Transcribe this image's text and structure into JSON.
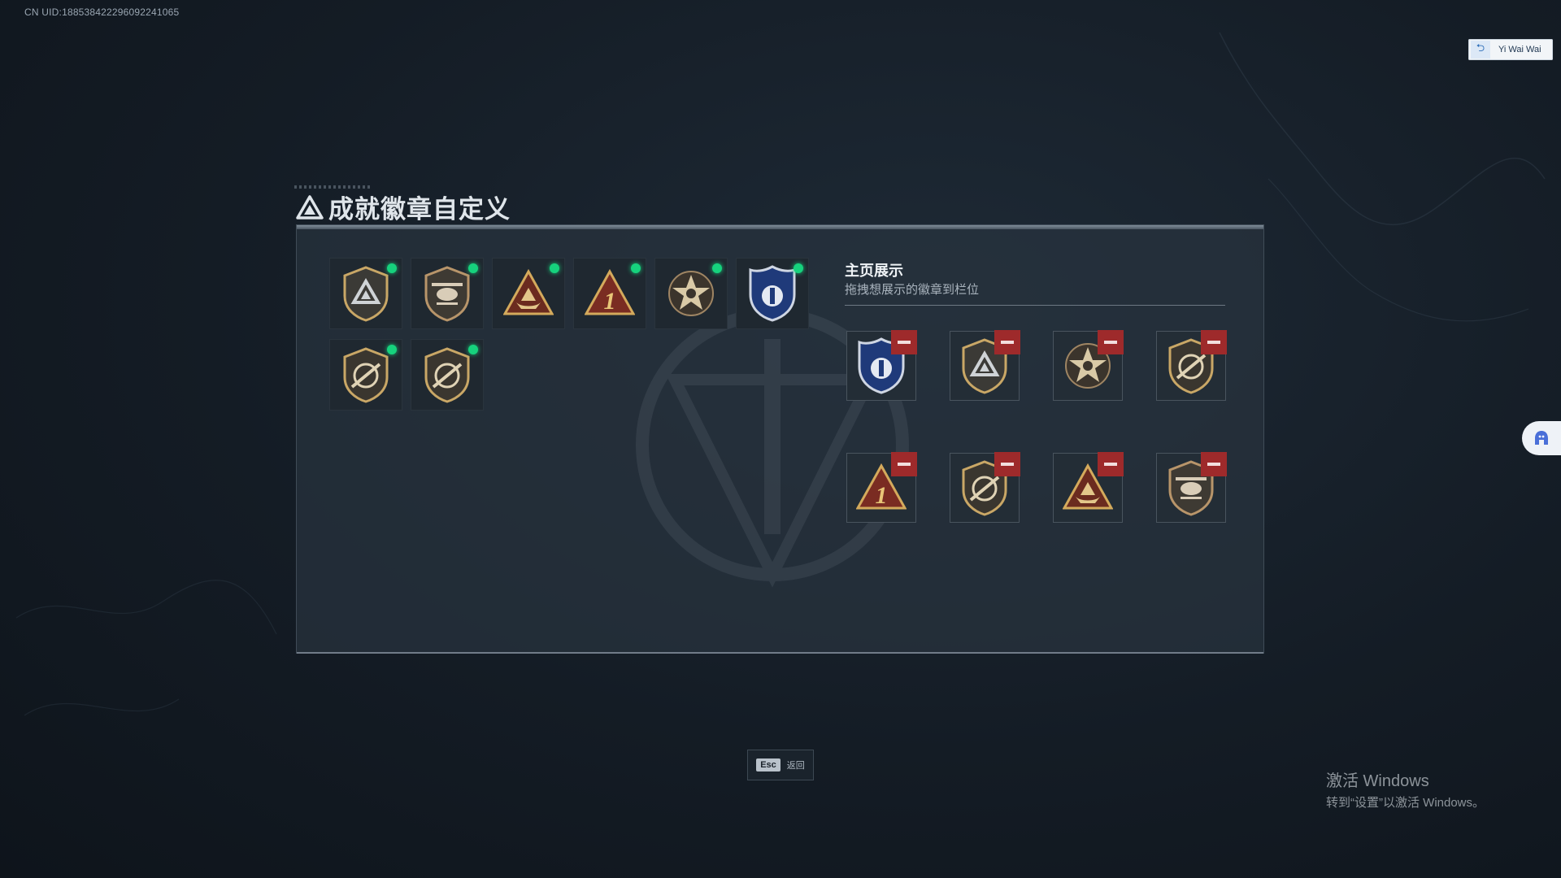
{
  "uid_text": "CN UID:188538422296092241065",
  "user": {
    "name": "Yi Wai Wai",
    "icon": "login-arrow-icon"
  },
  "panel": {
    "title": "成就徽章自定义",
    "title_icon": "triangle-logo-icon"
  },
  "inventory": {
    "badges": [
      {
        "name": "delta-shield-badge",
        "selected": true
      },
      {
        "name": "helicopter-shield-badge",
        "selected": true
      },
      {
        "name": "ship-triangle-badge",
        "selected": true
      },
      {
        "name": "number-one-triangle-badge",
        "selected": true
      },
      {
        "name": "star-wreath-badge",
        "selected": true
      },
      {
        "name": "blue-police-shield-badge",
        "selected": true
      },
      {
        "name": "rifle-target-shield-badge",
        "selected": true
      },
      {
        "name": "rifle-target-shield-badge-2",
        "selected": true
      }
    ]
  },
  "display": {
    "title": "主页展示",
    "subtitle": "拖拽想展示的徽章到栏位",
    "slots": [
      {
        "badge": "blue-police-shield-badge"
      },
      {
        "badge": "delta-shield-badge"
      },
      {
        "badge": "star-wreath-badge"
      },
      {
        "badge": "rifle-target-shield-badge"
      },
      {
        "badge": "number-one-triangle-badge"
      },
      {
        "badge": "rifle-target-shield-badge-2"
      },
      {
        "badge": "ship-triangle-badge"
      },
      {
        "badge": "helicopter-shield-badge"
      }
    ],
    "remove_icon": "minus-icon"
  },
  "footer": {
    "esc_key": "Esc",
    "esc_label": "返回"
  },
  "watermark": {
    "line1": "激活 Windows",
    "line2": "转到“设置”以激活 Windows。"
  },
  "colors": {
    "selected_dot": "#16d27d",
    "remove_button": "#9e2a2b",
    "gold": "#c9a766"
  }
}
